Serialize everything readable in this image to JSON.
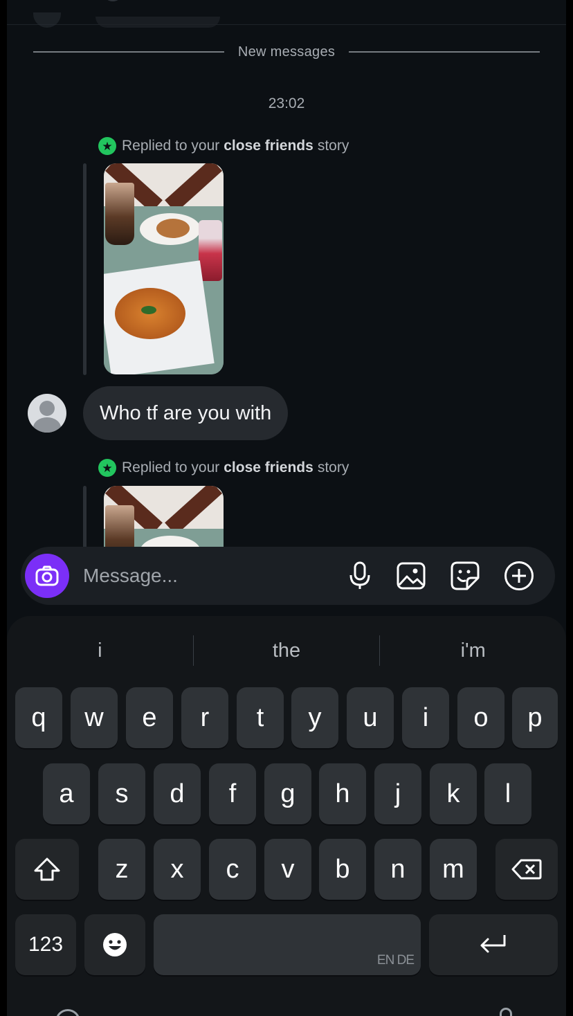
{
  "chat": {
    "divider_label": "New messages",
    "timestamp": "23:02",
    "reply_notes": [
      {
        "prefix": "Replied to your",
        "emphasis": "close friends",
        "suffix": "story"
      },
      {
        "prefix": "Replied to your",
        "emphasis": "close friends",
        "suffix": "story"
      }
    ],
    "messages": [
      {
        "text": "Who tf are you with"
      }
    ]
  },
  "composer": {
    "placeholder": "Message...",
    "icons": [
      "camera-icon",
      "microphone-icon",
      "gallery-icon",
      "sticker-icon",
      "plus-icon"
    ]
  },
  "keyboard": {
    "suggestions": [
      "i",
      "the",
      "i'm"
    ],
    "row1": [
      "q",
      "w",
      "e",
      "r",
      "t",
      "y",
      "u",
      "i",
      "o",
      "p"
    ],
    "row2": [
      "a",
      "s",
      "d",
      "f",
      "g",
      "h",
      "j",
      "k",
      "l"
    ],
    "row3": [
      "z",
      "x",
      "c",
      "v",
      "b",
      "n",
      "m"
    ],
    "numbers_label": "123",
    "space_language": "EN DE"
  },
  "colors": {
    "background": "#0c1014",
    "bubble": "#262a2f",
    "camera_button": "#7b2ff7",
    "close_friends_badge": "#22c55e",
    "key": "#2f3337"
  }
}
